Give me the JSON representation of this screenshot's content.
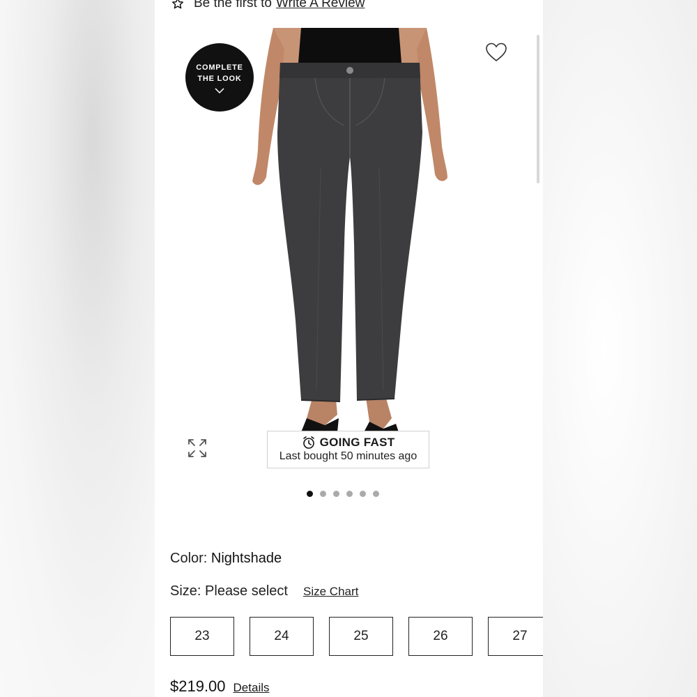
{
  "review": {
    "prefix": "Be the first to",
    "link": "Write A Review"
  },
  "complete_look": {
    "line1": "COMPLETE",
    "line2": "THE LOOK"
  },
  "badge": {
    "title": "GOING FAST",
    "subtitle": "Last bought 50 minutes ago"
  },
  "carousel": {
    "count": 6,
    "active": 0
  },
  "color": {
    "label": "Color:",
    "value": "Nightshade"
  },
  "size": {
    "label": "Size:",
    "value": "Please select",
    "chart_link": "Size Chart",
    "options": [
      "23",
      "24",
      "25",
      "26",
      "27"
    ]
  },
  "price": {
    "value": "$219.00",
    "details_link": "Details"
  },
  "colors": {
    "denim": "#3d3d3f",
    "accent": "#111111"
  },
  "icons": [
    "star-icon",
    "heart-icon",
    "expand-icon",
    "alarm-clock-icon",
    "chevron-down-icon"
  ]
}
